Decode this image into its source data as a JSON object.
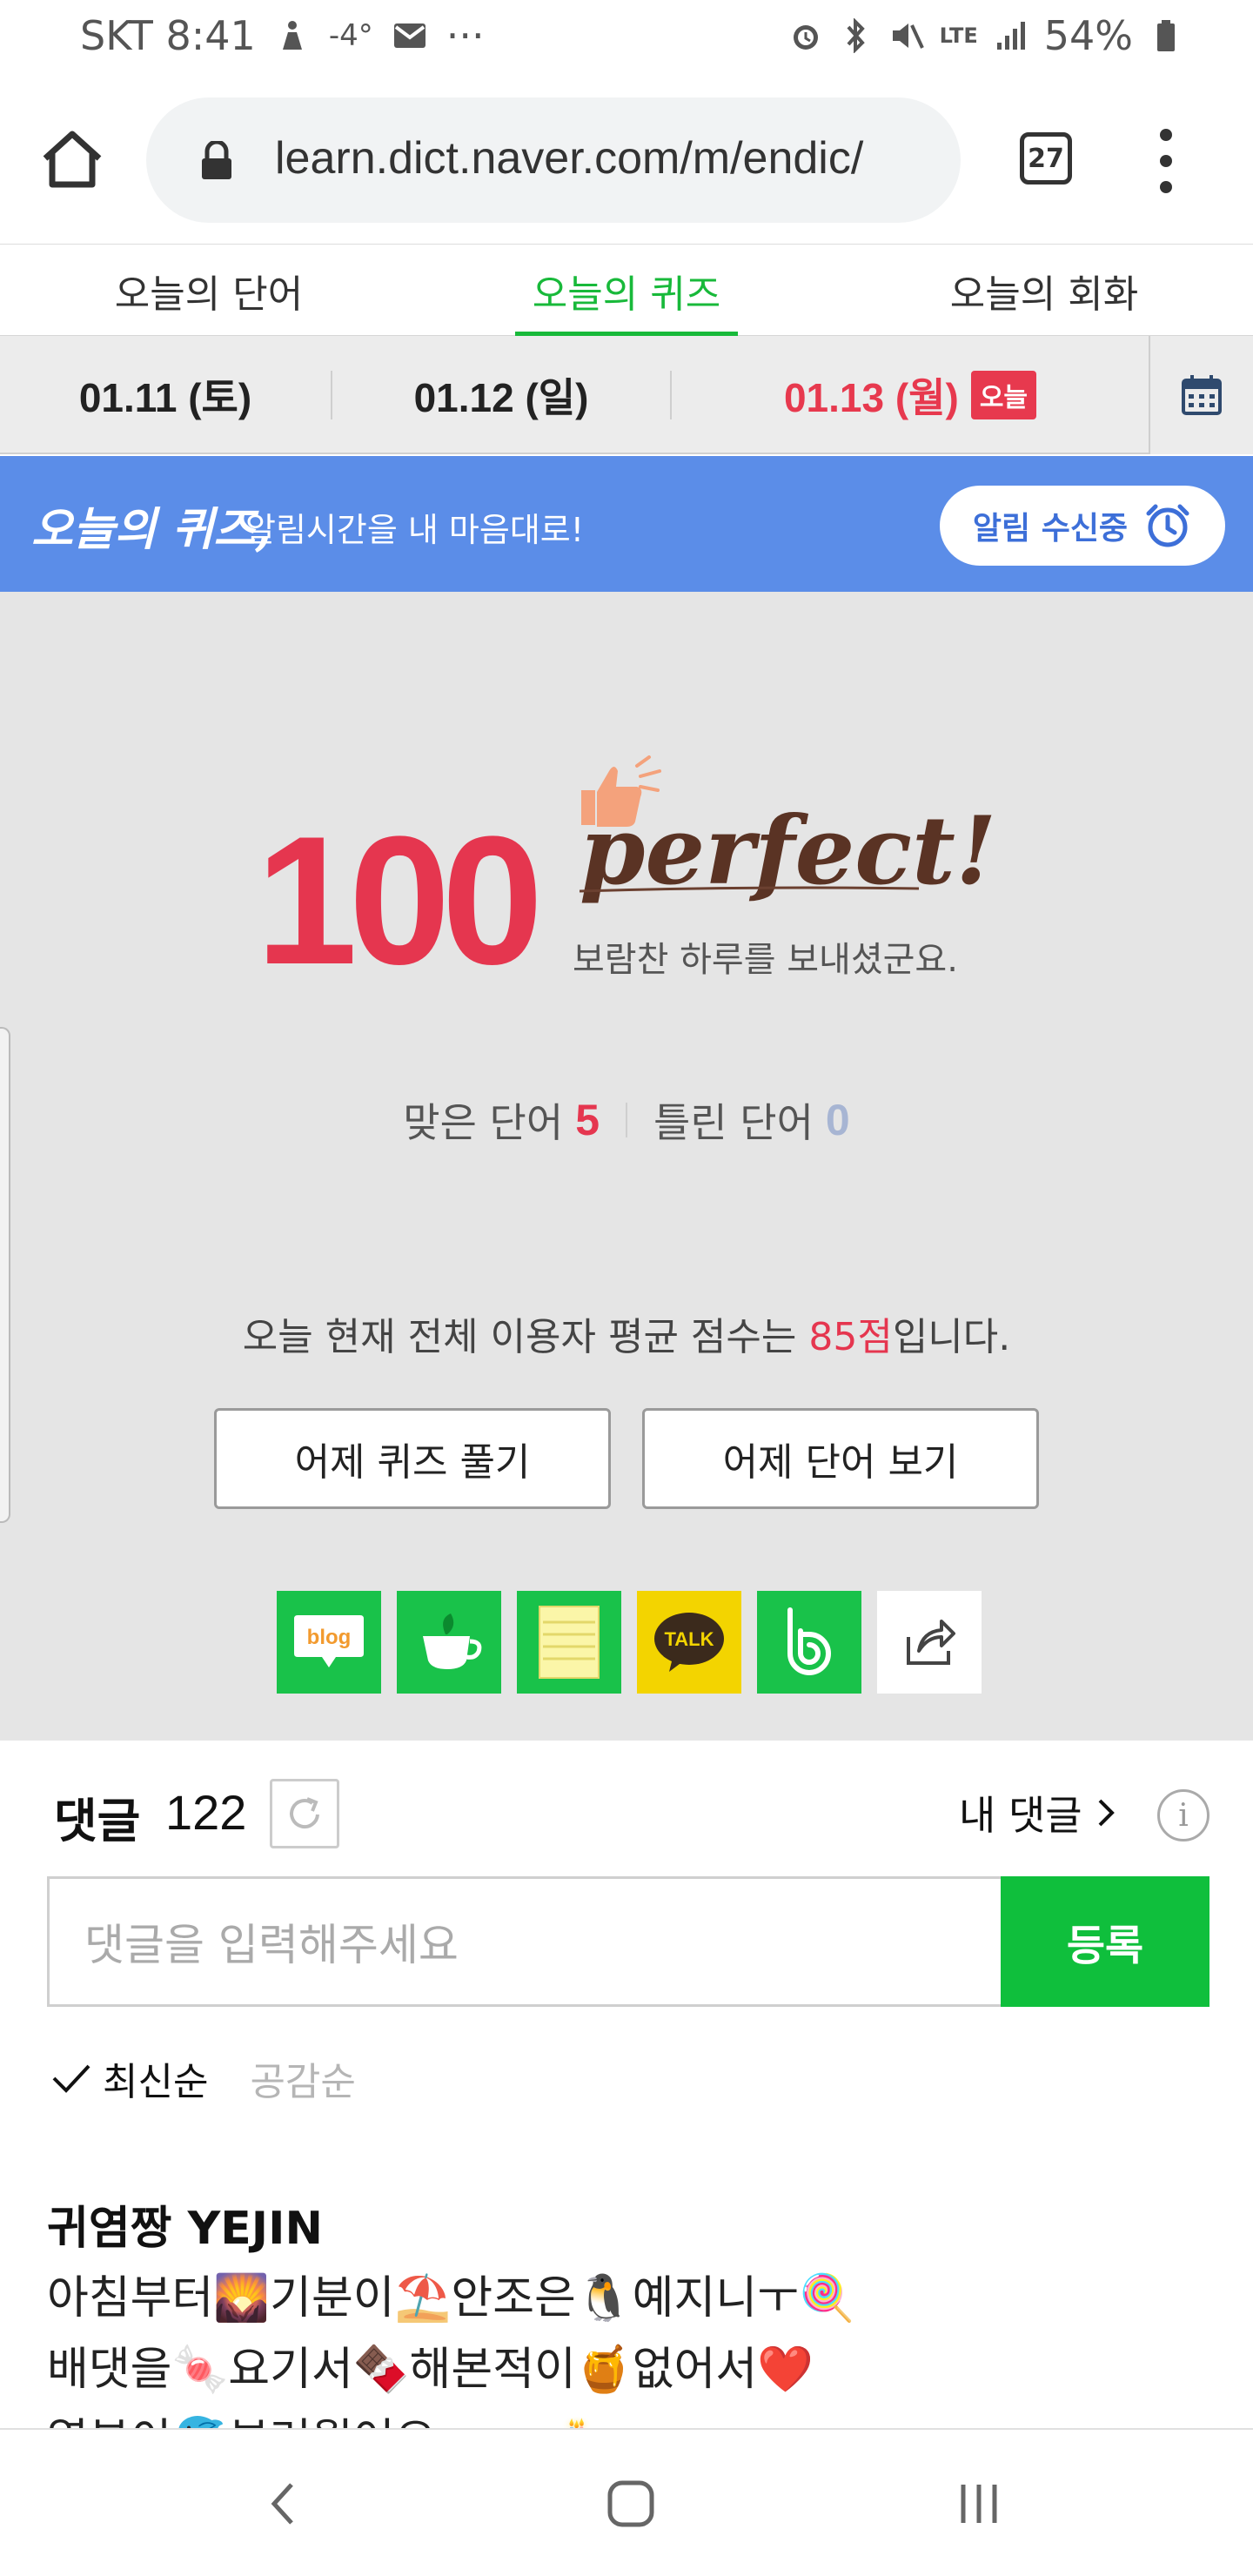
{
  "status_bar": {
    "carrier_time": "SKT 8:41",
    "weather": "-4°",
    "more": "···",
    "network": "LTE",
    "battery": "54%"
  },
  "browser": {
    "url": "learn.dict.naver.com/m/endic/",
    "tab_count": "27",
    "icons": [
      "home-icon",
      "lock-icon",
      "tab-switcher-icon",
      "more-vert-icon"
    ]
  },
  "tabs": [
    {
      "label": "오늘의 단어"
    },
    {
      "label": "오늘의 퀴즈",
      "active": true
    },
    {
      "label": "오늘의 회화"
    }
  ],
  "dates": [
    {
      "label": "01.11 (토)"
    },
    {
      "label": "01.12 (일)"
    },
    {
      "label": "01.13 (월)",
      "today": true
    }
  ],
  "today_badge": "오늘",
  "banner": {
    "title": "오늘의 퀴즈,",
    "subtitle": "알림시간을 내 마음대로!",
    "alarm_button": "알림 수신중"
  },
  "result": {
    "score": "100",
    "headline": "perfect!",
    "message": "보람찬 하루를 보내셨군요.",
    "correct_label": "맞은 단어",
    "correct_count": "5",
    "wrong_label": "틀린 단어",
    "wrong_count": "0",
    "average_prefix": "오늘 현재 전체 이용자 평균 점수는 ",
    "average_score": "85점",
    "average_suffix": "입니다.",
    "btn_yesterday_quiz": "어제 퀴즈 풀기",
    "btn_yesterday_words": "어제 단어 보기"
  },
  "share": {
    "blog_label": "blog",
    "talk_label": "TALK",
    "icons": [
      "blog-icon",
      "cafe-icon",
      "memo-icon",
      "kakaotalk-icon",
      "band-icon",
      "share-icon"
    ]
  },
  "comments": {
    "title": "댓글",
    "count": "122",
    "my_comments": "내 댓글",
    "placeholder": "댓글을 입력해주세요",
    "submit": "등록",
    "sort_latest": "최신순",
    "sort_likes": "공감순",
    "author": "귀염짱 YEJIN",
    "text_lines": [
      "아침부터🌄기분이⛱️안조은🐧예지니ㅜ🍭",
      "배댓을🍬요기서🍫해본적이🍯없어서❤️",
      "열분이🐬부러웠어요..ㅜㅜ🎂"
    ]
  },
  "colors": {
    "accent_green": "#18b93a",
    "score_red": "#e5364f",
    "banner_blue": "#5b8de8",
    "submit_green": "#0fbf3c"
  }
}
